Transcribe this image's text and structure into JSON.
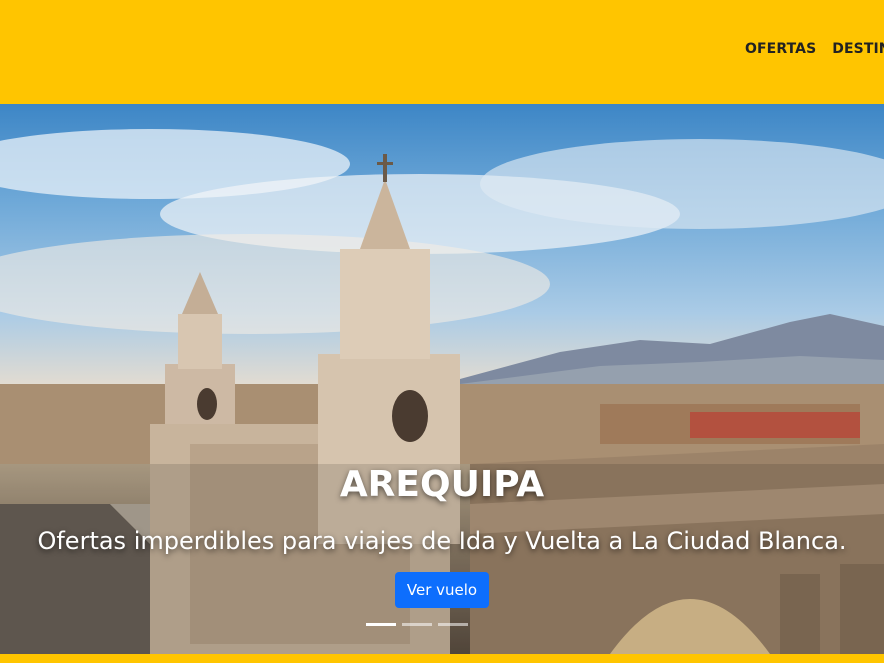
{
  "header": {
    "nav": [
      {
        "label": "OFERTAS"
      },
      {
        "label": "DESTIN"
      }
    ]
  },
  "hero": {
    "title": "AREQUIPA",
    "subtitle": "Ofertas imperdibles para viajes de Ida y Vuelta a La Ciudad Blanca.",
    "cta_label": "Ver vuelo",
    "slides_total": 3,
    "active_slide": 1
  },
  "colors": {
    "brand_yellow": "#ffc500",
    "button_blue": "#0d6efd",
    "nav_text": "#222222"
  }
}
